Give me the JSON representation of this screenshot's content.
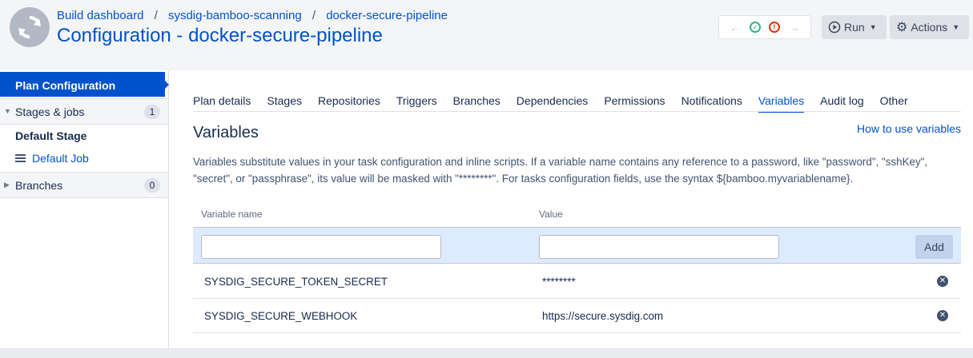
{
  "breadcrumb": {
    "items": [
      "Build dashboard",
      "sysdig-bamboo-scanning",
      "docker-secure-pipeline"
    ],
    "separator": "/"
  },
  "page_title": "Configuration - docker-secure-pipeline",
  "toolbar": {
    "run_label": "Run",
    "actions_label": "Actions"
  },
  "sidebar": {
    "active_label": "Plan Configuration",
    "stages_jobs": {
      "label": "Stages & jobs",
      "count": "1"
    },
    "stage_label": "Default Stage",
    "job_label": "Default Job",
    "branches": {
      "label": "Branches",
      "count": "0"
    }
  },
  "tabs": [
    "Plan details",
    "Stages",
    "Repositories",
    "Triggers",
    "Branches",
    "Dependencies",
    "Permissions",
    "Notifications",
    "Variables",
    "Audit log",
    "Other"
  ],
  "active_tab": "Variables",
  "section": {
    "title": "Variables",
    "help_link": "How to use variables",
    "description": "Variables substitute values in your task configuration and inline scripts. If a variable name contains any reference to a password, like \"password\", \"sshKey\", \"secret\", or \"passphrase\", its value will be masked with \"********\". For tasks configuration fields, use the syntax ${bamboo.myvariablename}."
  },
  "table": {
    "col_name": "Variable name",
    "col_value": "Value",
    "add_label": "Add",
    "new_name_value": "",
    "new_value_value": "",
    "rows": [
      {
        "name": "SYSDIG_SECURE_TOKEN_SECRET",
        "value": "********"
      },
      {
        "name": "SYSDIG_SECURE_WEBHOOK",
        "value": "https://secure.sysdig.com"
      }
    ]
  },
  "colors": {
    "accent": "#0052cc",
    "add_row_bg": "#deebff",
    "status_ok": "#36b37e",
    "status_fail": "#de350b"
  }
}
